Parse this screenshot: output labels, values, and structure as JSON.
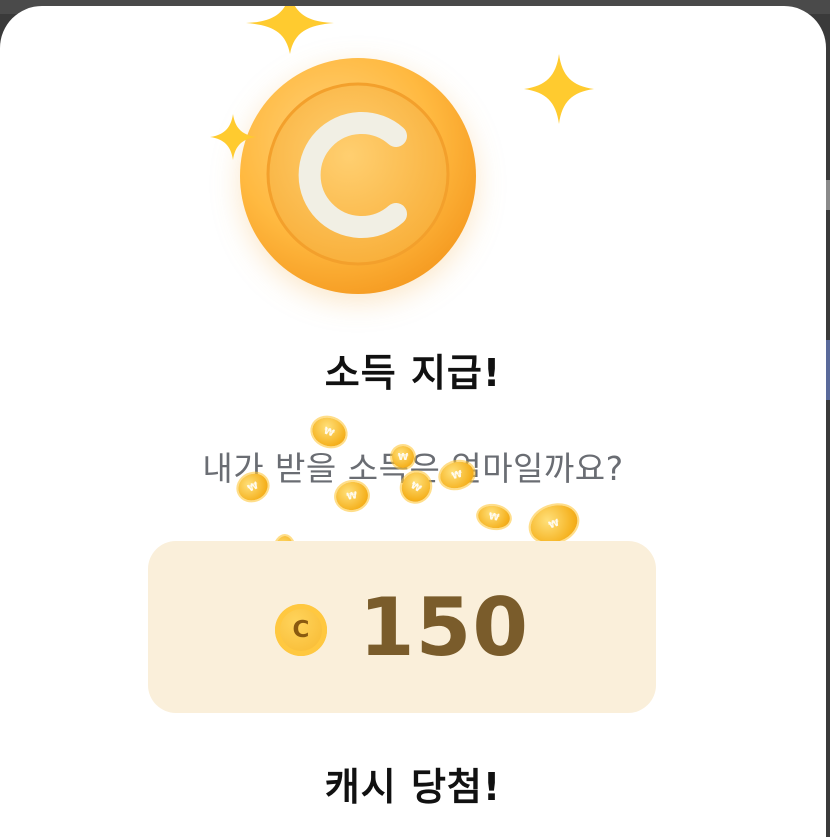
{
  "modal": {
    "title": "소득 지급!",
    "subtitle": "내가 받을 소득은 얼마일까요?",
    "reward": {
      "currency_symbol": "C",
      "amount": "150"
    },
    "footer_text": "캐시 당첨!",
    "hero_coin_letter": "C"
  },
  "colors": {
    "coin_orange": "#ffb940",
    "reward_background": "#faefda",
    "reward_amount": "#7a5c2b",
    "subtitle": "#6a6d73",
    "sparkle": "#ffcb2f"
  },
  "icons": [
    "hero-coin-icon",
    "sparkle-icon",
    "falling-coin-icon",
    "cash-coin-icon"
  ]
}
